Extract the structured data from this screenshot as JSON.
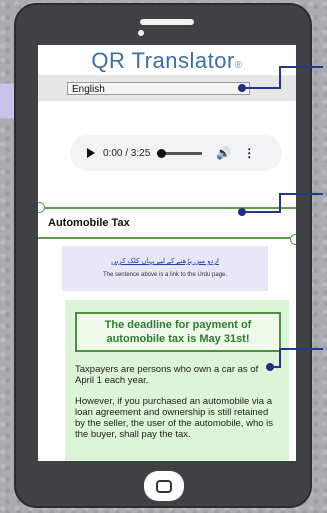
{
  "app": {
    "logo_text": "QR Translator",
    "logo_mark": "®"
  },
  "language": {
    "selected": "English"
  },
  "audio": {
    "time": "0:00 / 3:25"
  },
  "article": {
    "title": "Automobile Tax",
    "urdu_link": "اردو میں پڑھنے کے لیے یہاں کلک کریں",
    "urdu_note": "The sentence above is a link to the Urdu page.",
    "deadline": "The deadline for payment of automobile tax is May 31st!",
    "paragraph1": "Taxpayers are persons who own a car as of April 1 each year.",
    "paragraph2": "However, if you purchased an automobile via a loan agreement and ownership is still retained by the seller, the user of the automobile, who is the buyer, shall pay the tax."
  },
  "colors": {
    "accent_blue": "#3c6fa9",
    "green_border": "#5d9f4d",
    "callout": "#25368f"
  }
}
